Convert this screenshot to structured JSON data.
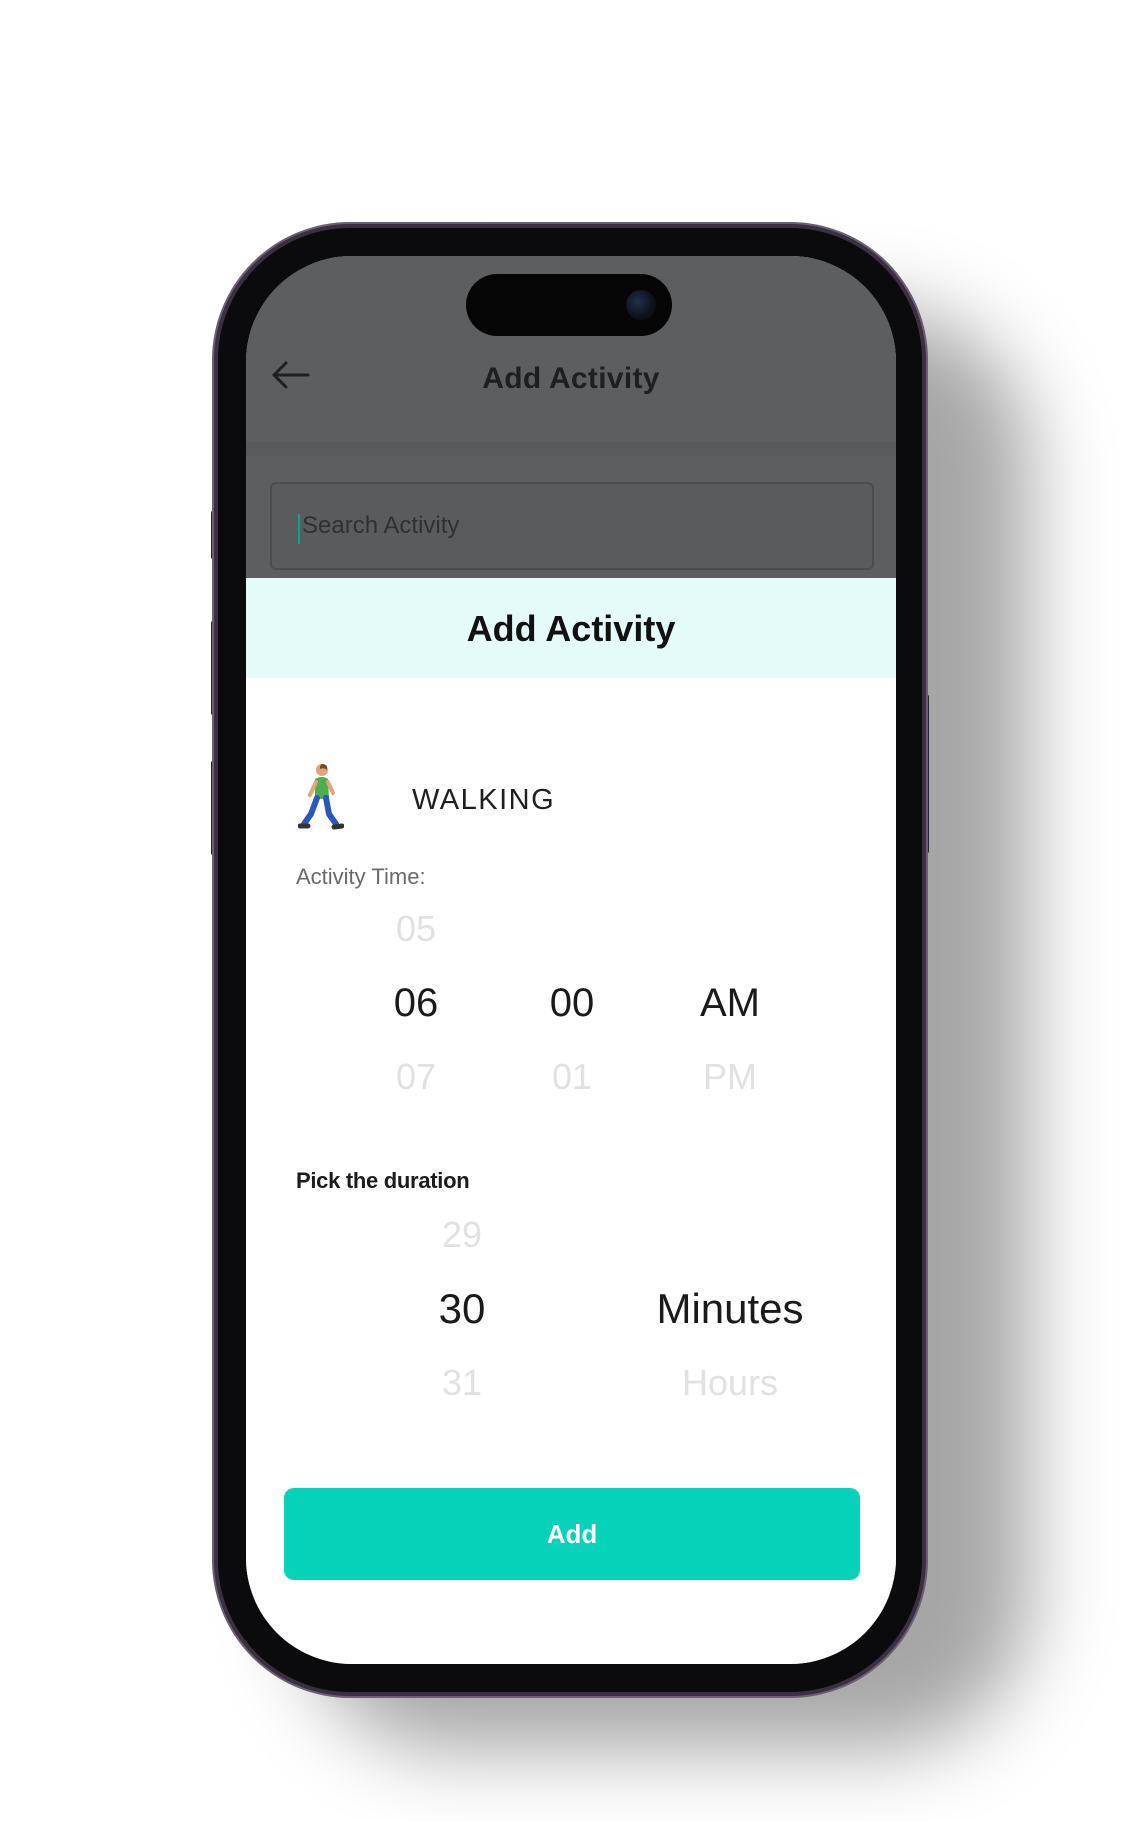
{
  "background_screen": {
    "title": "Add Activity",
    "search": {
      "placeholder": "Search Activity",
      "value": ""
    }
  },
  "sheet": {
    "title": "Add Activity",
    "activity": {
      "name": "WALKING",
      "icon": "walking-person-icon"
    },
    "activity_time": {
      "label": "Activity Time:",
      "hour": {
        "prev": "05",
        "selected": "06",
        "next": "07"
      },
      "minute": {
        "prev": "",
        "selected": "00",
        "next": "01"
      },
      "period": {
        "prev": "",
        "selected": "AM",
        "next": "PM"
      }
    },
    "duration": {
      "label": "Pick the duration",
      "value": {
        "prev": "29",
        "selected": "30",
        "next": "31"
      },
      "unit": {
        "prev": "",
        "selected": "Minutes",
        "next": "Hours"
      }
    },
    "add_button_label": "Add"
  },
  "colors": {
    "accent": "#05d2b9",
    "sheet_header": "#e5fbf9",
    "dimmed_overlay": "#5d5e60"
  }
}
